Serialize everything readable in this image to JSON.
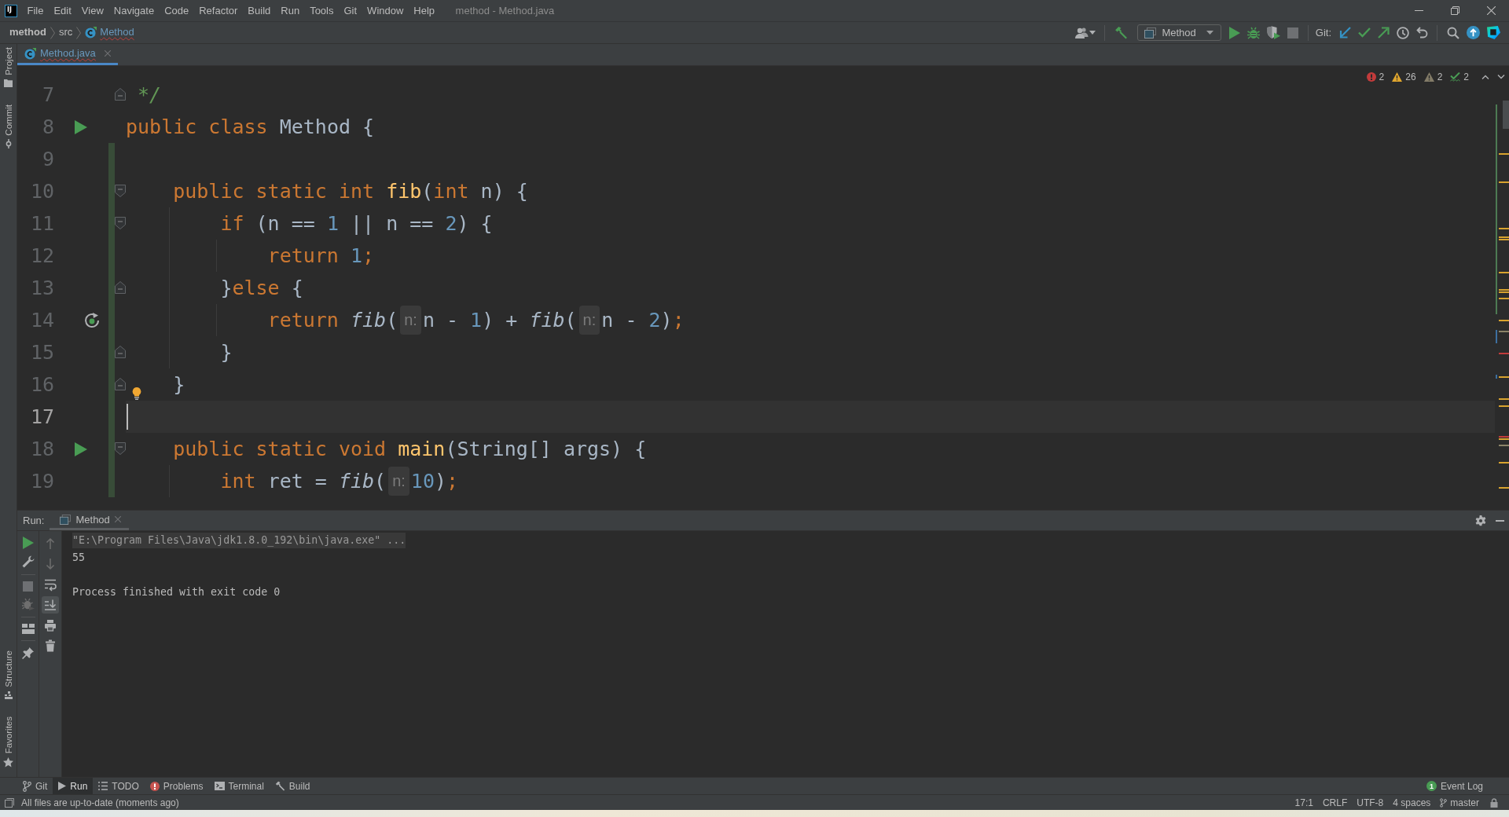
{
  "window": {
    "logo": "IJ",
    "title": "method - Method.java"
  },
  "menu": [
    "File",
    "Edit",
    "View",
    "Navigate",
    "Code",
    "Refactor",
    "Build",
    "Run",
    "Tools",
    "Git",
    "Window",
    "Help"
  ],
  "breadcrumbs": [
    {
      "label": "method",
      "kind": "project",
      "typo": false
    },
    {
      "label": "src",
      "kind": "folder",
      "typo": false
    },
    {
      "label": "Method",
      "kind": "class",
      "typo": true
    }
  ],
  "toolbar": {
    "groups": [
      [
        {
          "kind": "vcs_user",
          "disabled": false
        }
      ],
      [
        {
          "kind": "build",
          "disabled": false
        },
        {
          "kind": "run_config",
          "label": "Method",
          "disabled": false
        },
        {
          "kind": "run",
          "disabled": false
        },
        {
          "kind": "debug",
          "disabled": false
        },
        {
          "kind": "coverage",
          "disabled": false
        },
        {
          "kind": "stop",
          "disabled": true
        }
      ],
      [
        {
          "kind": "vcs_label",
          "label": "Git:",
          "disabled": false
        },
        {
          "kind": "update",
          "disabled": false
        },
        {
          "kind": "commit",
          "disabled": false
        },
        {
          "kind": "push",
          "disabled": false
        },
        {
          "kind": "history",
          "disabled": false
        },
        {
          "kind": "rollback",
          "disabled": false
        }
      ],
      [
        {
          "kind": "search",
          "disabled": false
        },
        {
          "kind": "updates",
          "disabled": false
        },
        {
          "kind": "toolbox",
          "disabled": false
        }
      ]
    ]
  },
  "side_tools": {
    "top": [
      {
        "label": "Project",
        "kind": "project",
        "selected": false
      },
      {
        "label": "Commit",
        "kind": "commit",
        "selected": false
      }
    ],
    "bottom": [
      {
        "label": "Structure",
        "kind": "structure",
        "selected": false
      },
      {
        "label": "Favorites",
        "kind": "favorites",
        "selected": false
      }
    ]
  },
  "tabs": [
    {
      "label": "Method.java",
      "selected": true,
      "typo": true
    }
  ],
  "inspections": [
    {
      "kind": "error",
      "count": "2"
    },
    {
      "kind": "warning",
      "count": "26"
    },
    {
      "kind": "weak_warning",
      "count": "2"
    },
    {
      "kind": "typo",
      "count": "2"
    }
  ],
  "editor": {
    "lines": [
      {
        "number": "7",
        "current": false,
        "changed": false,
        "fold_start": false,
        "fold_end": true,
        "runnable": false,
        "recursive": false,
        "intention": false,
        "segments": [
          {
            "kind": "code",
            "tokens": [
              {
                "text": " */",
                "kind": "doc_comment"
              }
            ]
          }
        ]
      },
      {
        "number": "8",
        "current": false,
        "changed": false,
        "fold_start": false,
        "fold_end": false,
        "runnable": true,
        "recursive": false,
        "intention": false,
        "segments": [
          {
            "kind": "code",
            "tokens": [
              {
                "text": "public class ",
                "kind": "keyword"
              },
              {
                "text": "Method {",
                "kind": "plain"
              }
            ]
          }
        ],
        "children": [
          {
            "number": "9",
            "current": false,
            "changed": true,
            "fold_start": false,
            "fold_end": false,
            "runnable": false,
            "recursive": false,
            "intention": false
          },
          {
            "number": "10",
            "current": false,
            "changed": true,
            "fold_start": true,
            "fold_end": false,
            "runnable": false,
            "recursive": false,
            "intention": false,
            "segments": [
              {
                "kind": "code",
                "tokens": [
                  {
                    "text": "public static int ",
                    "kind": "keyword"
                  },
                  {
                    "text": "fib",
                    "kind": "declaration"
                  },
                  {
                    "text": "(",
                    "kind": "plain"
                  },
                  {
                    "text": "int ",
                    "kind": "keyword"
                  },
                  {
                    "text": "n) {",
                    "kind": "plain"
                  }
                ]
              }
            ],
            "children": [
              {
                "number": "11",
                "current": false,
                "changed": true,
                "fold_start": true,
                "fold_end": false,
                "runnable": false,
                "recursive": false,
                "intention": false,
                "segments": [
                  {
                    "kind": "code",
                    "tokens": [
                      {
                        "text": "if ",
                        "kind": "keyword"
                      },
                      {
                        "text": "(n == ",
                        "kind": "plain"
                      },
                      {
                        "text": "1",
                        "kind": "number"
                      },
                      {
                        "text": " || n == ",
                        "kind": "plain"
                      },
                      {
                        "text": "2",
                        "kind": "number"
                      },
                      {
                        "text": ") {",
                        "kind": "plain"
                      }
                    ]
                  }
                ],
                "children": [
                  {
                    "number": "12",
                    "current": false,
                    "changed": true,
                    "fold_start": false,
                    "fold_end": false,
                    "runnable": false,
                    "recursive": false,
                    "intention": false,
                    "segments": [
                      {
                        "kind": "code",
                        "tokens": [
                          {
                            "text": "return ",
                            "kind": "keyword"
                          },
                          {
                            "text": "1",
                            "kind": "number"
                          },
                          {
                            "text": ";",
                            "kind": "keyword"
                          }
                        ]
                      }
                    ]
                  }
                ]
              },
              {
                "number": "13",
                "current": false,
                "changed": true,
                "fold_start": false,
                "fold_end": true,
                "runnable": false,
                "recursive": false,
                "intention": false,
                "segments": [
                  {
                    "kind": "code",
                    "tokens": [
                      {
                        "text": "}",
                        "kind": "plain"
                      },
                      {
                        "text": "else ",
                        "kind": "keyword"
                      },
                      {
                        "text": "{",
                        "kind": "plain"
                      }
                    ]
                  }
                ],
                "children": [
                  {
                    "number": "14",
                    "current": false,
                    "changed": true,
                    "fold_start": false,
                    "fold_end": false,
                    "runnable": false,
                    "recursive": true,
                    "intention": false,
                    "segments": [
                      {
                        "kind": "code",
                        "tokens": [
                          {
                            "text": "return ",
                            "kind": "keyword"
                          },
                          {
                            "text": "fib",
                            "kind": "static_call"
                          },
                          {
                            "text": "(",
                            "kind": "plain"
                          }
                        ]
                      },
                      {
                        "kind": "hint",
                        "text": "n:"
                      },
                      {
                        "kind": "code",
                        "tokens": [
                          {
                            "text": "n - ",
                            "kind": "plain"
                          },
                          {
                            "text": "1",
                            "kind": "number"
                          },
                          {
                            "text": ") + ",
                            "kind": "plain"
                          },
                          {
                            "text": "fib",
                            "kind": "static_call"
                          },
                          {
                            "text": "(",
                            "kind": "plain"
                          }
                        ]
                      },
                      {
                        "kind": "hint",
                        "text": "n:"
                      },
                      {
                        "kind": "code",
                        "tokens": [
                          {
                            "text": "n - ",
                            "kind": "plain"
                          },
                          {
                            "text": "2",
                            "kind": "number"
                          },
                          {
                            "text": ")",
                            "kind": "plain"
                          },
                          {
                            "text": ";",
                            "kind": "keyword"
                          }
                        ]
                      }
                    ]
                  }
                ]
              },
              {
                "number": "15",
                "current": false,
                "changed": true,
                "fold_start": false,
                "fold_end": true,
                "runnable": false,
                "recursive": false,
                "intention": false,
                "segments": [
                  {
                    "kind": "code",
                    "tokens": [
                      {
                        "text": "}",
                        "kind": "plain"
                      }
                    ]
                  }
                ]
              }
            ]
          },
          {
            "number": "16",
            "current": false,
            "changed": true,
            "fold_start": false,
            "fold_end": true,
            "runnable": false,
            "recursive": false,
            "intention": true,
            "segments": [
              {
                "kind": "code",
                "tokens": [
                  {
                    "text": "}",
                    "kind": "plain"
                  }
                ]
              }
            ]
          },
          {
            "number": "17",
            "current": true,
            "changed": true,
            "fold_start": false,
            "fold_end": false,
            "runnable": false,
            "recursive": false,
            "intention": false
          },
          {
            "number": "18",
            "current": false,
            "changed": true,
            "fold_start": true,
            "fold_end": false,
            "runnable": true,
            "recursive": false,
            "intention": false,
            "segments": [
              {
                "kind": "code",
                "tokens": [
                  {
                    "text": "public static void ",
                    "kind": "keyword"
                  },
                  {
                    "text": "main",
                    "kind": "declaration"
                  },
                  {
                    "text": "(String[] args) {",
                    "kind": "plain"
                  }
                ]
              }
            ],
            "children": [
              {
                "number": "19",
                "current": false,
                "changed": true,
                "fold_start": false,
                "fold_end": false,
                "runnable": false,
                "recursive": false,
                "intention": false,
                "segments": [
                  {
                    "kind": "code",
                    "tokens": [
                      {
                        "text": "int ",
                        "kind": "keyword"
                      },
                      {
                        "text": "ret = ",
                        "kind": "plain"
                      },
                      {
                        "text": "fib",
                        "kind": "static_call"
                      },
                      {
                        "text": "(",
                        "kind": "plain"
                      }
                    ]
                  },
                  {
                    "kind": "hint",
                    "text": "n:"
                  },
                  {
                    "kind": "code",
                    "tokens": [
                      {
                        "text": "10",
                        "kind": "number"
                      },
                      {
                        "text": ")",
                        "kind": "plain"
                      },
                      {
                        "text": ";",
                        "kind": "keyword"
                      }
                    ]
                  }
                ]
              }
            ]
          }
        ]
      }
    ]
  },
  "run_panel": {
    "label": "Run:",
    "tabs": [
      {
        "label": "Method",
        "selected": true
      }
    ],
    "actions": [
      [
        {
          "kind": "rerun",
          "disabled": false
        },
        {
          "kind": "edit_config",
          "disabled": false
        }
      ],
      [
        {
          "kind": "stop",
          "disabled": true
        },
        {
          "kind": "attach_debugger",
          "disabled": true
        }
      ],
      [
        {
          "kind": "layout",
          "disabled": false
        }
      ],
      [
        {
          "kind": "pin",
          "disabled": false
        }
      ]
    ],
    "console_actions": [
      {
        "kind": "previous",
        "disabled": true,
        "selected": false
      },
      {
        "kind": "next",
        "disabled": true,
        "selected": false
      },
      {
        "kind": "soft_wrap",
        "disabled": false,
        "selected": false
      },
      {
        "kind": "scroll_end",
        "disabled": false,
        "selected": true
      },
      {
        "kind": "print",
        "disabled": false,
        "selected": false
      },
      {
        "kind": "clear",
        "disabled": false,
        "selected": false
      }
    ],
    "console": [
      {
        "kind": "command",
        "text": "\"E:\\Program Files\\Java\\jdk1.8.0_192\\bin\\java.exe\" ..."
      },
      {
        "kind": "output",
        "text": "55"
      },
      {
        "kind": "status",
        "text": "Process finished with exit code 0"
      }
    ]
  },
  "tool_windows": [
    {
      "label": "Git",
      "kind": "git",
      "selected": false
    },
    {
      "label": "Run",
      "kind": "run",
      "selected": true
    },
    {
      "label": "TODO",
      "kind": "todo",
      "selected": false
    },
    {
      "label": "Problems",
      "kind": "problems",
      "selected": false
    },
    {
      "label": "Terminal",
      "kind": "terminal",
      "selected": false
    },
    {
      "label": "Build",
      "kind": "build",
      "selected": false
    }
  ],
  "event_log": {
    "label": "Event Log",
    "badge": "1"
  },
  "status_bar": {
    "message": "All files are up-to-date (moments ago)",
    "items": [
      {
        "kind": "caret_position",
        "text": "17:1"
      },
      {
        "kind": "line_separator",
        "text": "CRLF"
      },
      {
        "kind": "encoding",
        "text": "UTF-8"
      },
      {
        "kind": "indent",
        "text": "4 spaces"
      },
      {
        "kind": "branch",
        "text": "master"
      }
    ]
  }
}
